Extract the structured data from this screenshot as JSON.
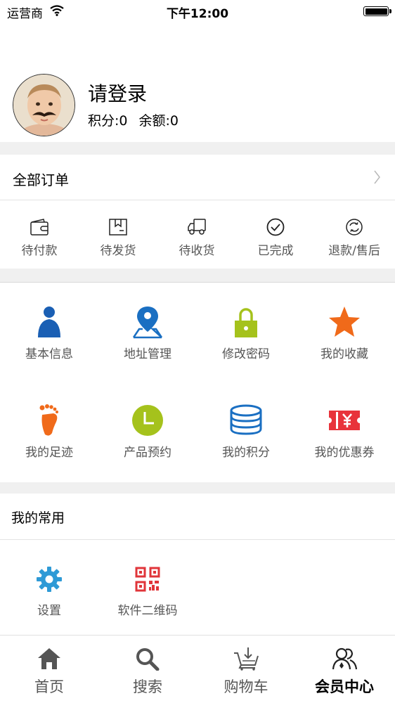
{
  "status_bar": {
    "carrier": "运营商",
    "time": "下午12:00"
  },
  "profile": {
    "login_prompt": "请登录",
    "points_text": "积分:0",
    "balance_text": "余额:0"
  },
  "orders": {
    "title": "全部订单",
    "statuses": [
      {
        "label": "待付款",
        "icon": "wallet-icon"
      },
      {
        "label": "待发货",
        "icon": "package-icon"
      },
      {
        "label": "待收货",
        "icon": "truck-icon"
      },
      {
        "label": "已完成",
        "icon": "check-circle-icon"
      },
      {
        "label": "退款/售后",
        "icon": "refund-icon"
      }
    ]
  },
  "menu": {
    "items": [
      {
        "label": "基本信息",
        "icon": "person-icon",
        "color": "#1a5fb4"
      },
      {
        "label": "地址管理",
        "icon": "map-pin-icon",
        "color": "#1a6fc2"
      },
      {
        "label": "修改密码",
        "icon": "lock-icon",
        "color": "#a5c21c"
      },
      {
        "label": "我的收藏",
        "icon": "star-icon",
        "color": "#f06a1a"
      },
      {
        "label": "我的足迹",
        "icon": "footprint-icon",
        "color": "#f06a1a"
      },
      {
        "label": "产品预约",
        "icon": "clock-icon",
        "color": "#a5c21c"
      },
      {
        "label": "我的积分",
        "icon": "coins-icon",
        "color": "#1a6fc2"
      },
      {
        "label": "我的优惠券",
        "icon": "coupon-icon",
        "color": "#e8333b"
      }
    ]
  },
  "common": {
    "title": "我的常用",
    "items": [
      {
        "label": "设置",
        "icon": "gear-icon",
        "color": "#2e9ad6"
      },
      {
        "label": "软件二维码",
        "icon": "qr-code-icon",
        "color": "#e0353a"
      }
    ]
  },
  "tabbar": {
    "tabs": [
      {
        "label": "首页",
        "icon": "home-icon",
        "active": false
      },
      {
        "label": "搜索",
        "icon": "search-icon",
        "active": false
      },
      {
        "label": "购物车",
        "icon": "cart-icon",
        "active": false
      },
      {
        "label": "会员中心",
        "icon": "members-icon",
        "active": true
      }
    ]
  }
}
